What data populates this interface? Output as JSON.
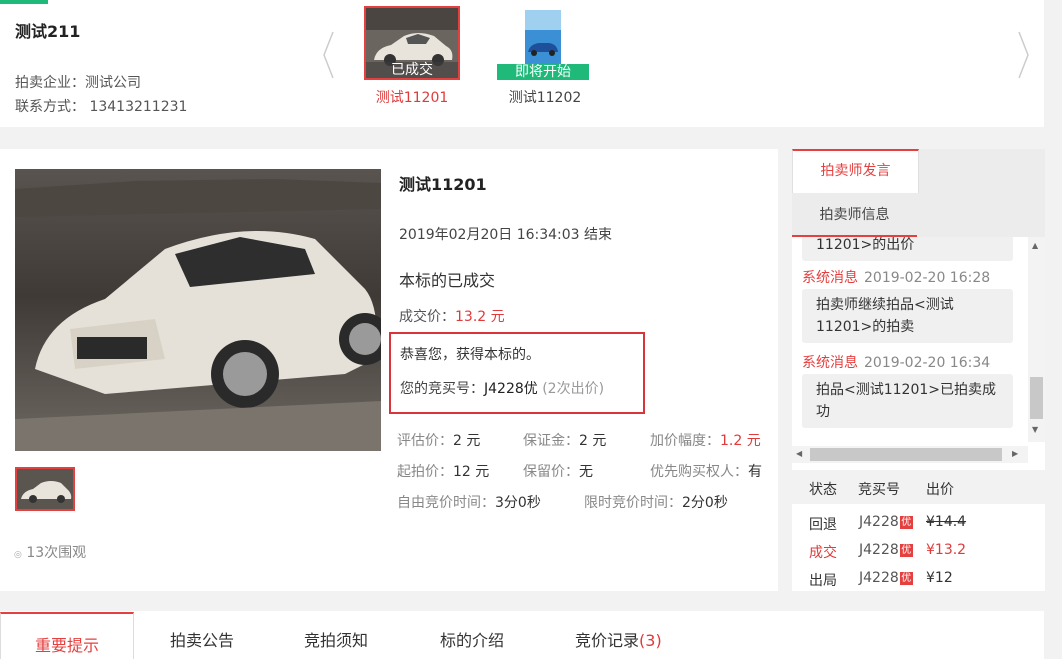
{
  "session": {
    "title": "测试211",
    "company": "拍卖企业：测试公司",
    "contact": "联系方式： 13413211231"
  },
  "lots": [
    {
      "flag": "已成交",
      "name": "测试11201"
    },
    {
      "flag": "即将开始",
      "name": "测试11202"
    }
  ],
  "lot": {
    "name": "测试11201",
    "end_time": "2019年02月20日 16:34:03 结束",
    "status": "本标的已成交",
    "deal_label": "成交价：",
    "deal_value": "13.2 元",
    "congrats": "恭喜您，获得本标的。",
    "bid_no_label": "您的竞买号：",
    "bid_no": "J4228优",
    "bid_count": "(2次出价)",
    "views": "13次围观",
    "info": {
      "estimate_label": "评估价：",
      "estimate_value": "2 元",
      "deposit_label": "保证金：",
      "deposit_value": "2 元",
      "increment_label": "加价幅度：",
      "increment_value": "1.2 元",
      "start_label": "起拍价：",
      "start_value": "12 元",
      "reserve_label": "保留价：",
      "reserve_value": "无",
      "priority_label": "优先购买权人：",
      "priority_value": "有",
      "free_time_label": "自由竞价时间：",
      "free_time_value": "3分0秒",
      "limit_time_label": "限时竞价时间：",
      "limit_time_value": "2分0秒"
    }
  },
  "right": {
    "tab_active": "拍卖师发言",
    "tab_other": "拍卖师信息",
    "messages": [
      {
        "text_partial": "11201>的出价"
      },
      {
        "sys": "系统消息",
        "time": "2019-02-20 16:28",
        "text": "拍卖师继续拍品<测试11201>的拍卖"
      },
      {
        "sys": "系统消息",
        "time": "2019-02-20 16:34",
        "text": "拍品<测试11201>已拍卖成功"
      }
    ],
    "bid_headers": [
      "状态",
      "竞买号",
      "出价"
    ],
    "bids": [
      {
        "status": "回退",
        "no": "J4228",
        "badge": "优",
        "price": "¥14.4"
      },
      {
        "status": "成交",
        "no": "J4228",
        "badge": "优",
        "price": "¥13.2"
      },
      {
        "status": "出局",
        "no": "J4228",
        "badge": "优",
        "price": "¥12"
      }
    ]
  },
  "tabs": {
    "notice": "重要提示",
    "announcement": "拍卖公告",
    "rules": "竞拍须知",
    "intro": "标的介绍",
    "records": "竞价记录",
    "records_count": "(3)"
  },
  "colors": {
    "accent": "#e54040",
    "green": "#1fb97a"
  }
}
